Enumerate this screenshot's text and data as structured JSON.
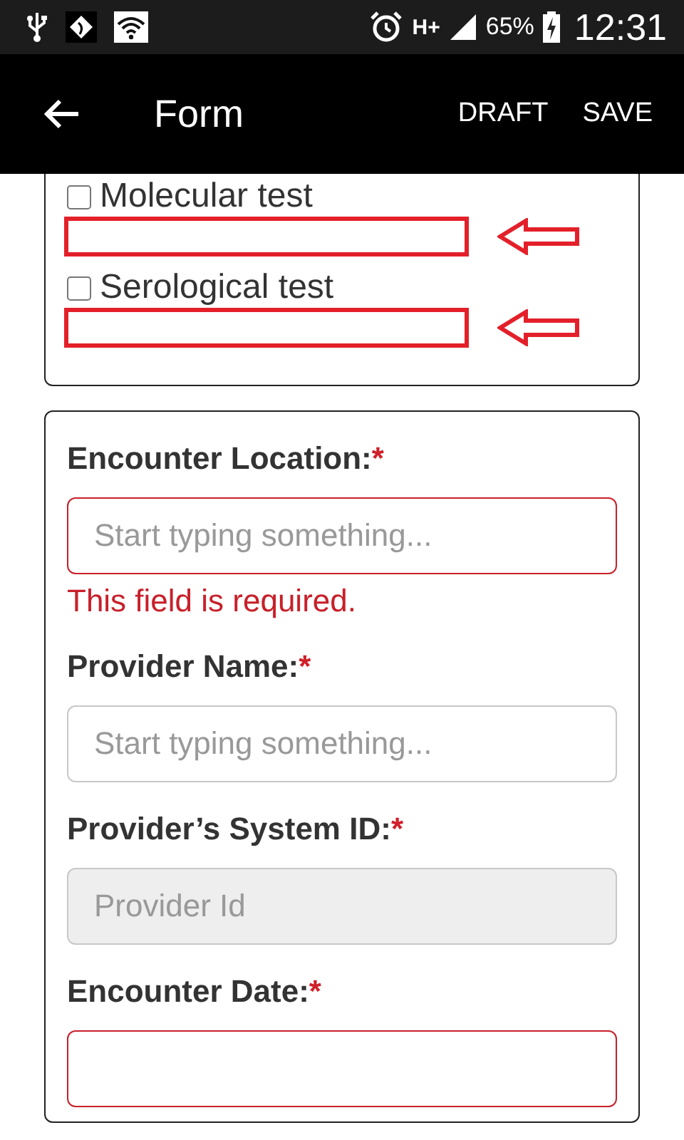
{
  "status_bar": {
    "network_type": "H+",
    "battery": "65%",
    "time": "12:31"
  },
  "app_bar": {
    "title": "Form",
    "actions": [
      "DRAFT",
      "SAVE"
    ]
  },
  "test_options": [
    {
      "label": "Molecular test",
      "checked": false,
      "highlighted": true
    },
    {
      "label": "Serological test",
      "checked": false,
      "highlighted": true
    }
  ],
  "fields": [
    {
      "label": "Encounter Location:",
      "required_mark": "*",
      "placeholder": "Start typing something...",
      "disabled": false,
      "invalid": true,
      "error": "This field is required."
    },
    {
      "label": "Provider Name:",
      "required_mark": "*",
      "placeholder": "Start typing something...",
      "disabled": false,
      "invalid": false
    },
    {
      "label": "Provider’s System ID:",
      "required_mark": "*",
      "placeholder": "Provider Id",
      "disabled": true,
      "invalid": false
    },
    {
      "label": "Encounter Date:",
      "required_mark": "*",
      "disabled": false,
      "invalid": true
    }
  ]
}
